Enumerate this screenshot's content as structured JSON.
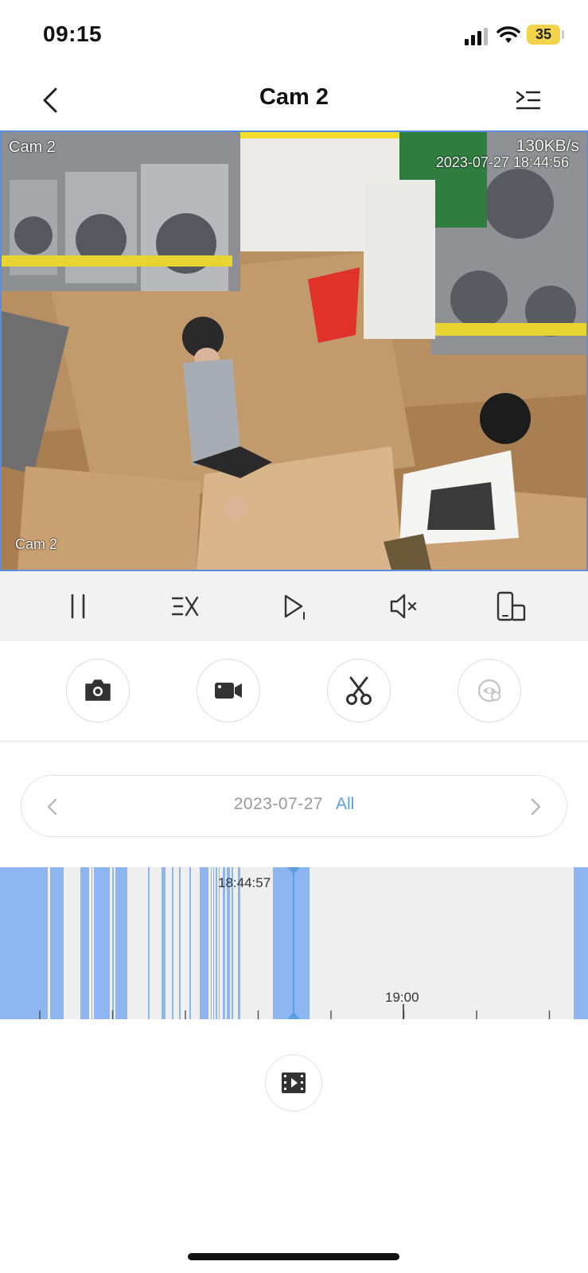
{
  "status_bar": {
    "time": "09:15",
    "battery": "35"
  },
  "nav": {
    "title": "Cam 2"
  },
  "video": {
    "osd_camera_top": "Cam 2",
    "osd_bitrate": "130KB/s",
    "osd_timestamp": "2023-07-27 18:44:56",
    "osd_camera_bottom": "Cam 2"
  },
  "date_picker": {
    "date": "2023-07-27",
    "filter": "All"
  },
  "timeline": {
    "current_time": "18:44:57",
    "hour_label": "19:00",
    "segment_color": "#8db6f1",
    "cursor_color": "#5c9ee6"
  },
  "colors": {
    "accent": "#5c9ee6",
    "battery": "#f3d34a"
  }
}
